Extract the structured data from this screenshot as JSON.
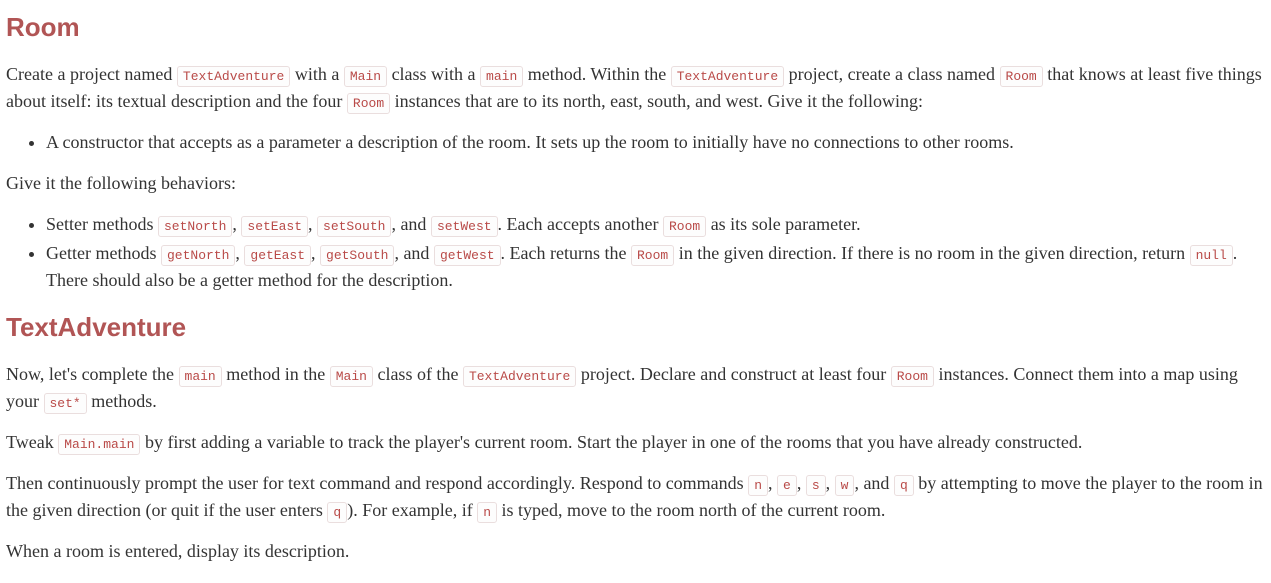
{
  "sections": {
    "room": {
      "heading": "Room",
      "p1": {
        "t1": "Create a project named ",
        "c1": "TextAdventure",
        "t2": " with a ",
        "c2": "Main",
        "t3": " class with a ",
        "c3": "main",
        "t4": " method. Within the ",
        "c4": "TextAdventure",
        "t5": " project, create a class named ",
        "c5": "Room",
        "t6": " that knows at least five things about itself: its textual description and the four ",
        "c6": "Room",
        "t7": " instances that are to its north, east, south, and west. Give it the following:"
      },
      "list1": {
        "li1": "A constructor that accepts as a parameter a description of the room. It sets up the room to initially have no connections to other rooms."
      },
      "p2": "Give it the following behaviors:",
      "list2": {
        "li1": {
          "t1": "Setter methods ",
          "c1": "setNorth",
          "t2": ", ",
          "c2": "setEast",
          "t3": ", ",
          "c3": "setSouth",
          "t4": ", and ",
          "c4": "setWest",
          "t5": ". Each accepts another ",
          "c5": "Room",
          "t6": " as its sole parameter."
        },
        "li2": {
          "t1": "Getter methods ",
          "c1": "getNorth",
          "t2": ", ",
          "c2": "getEast",
          "t3": ", ",
          "c3": "getSouth",
          "t4": ", and ",
          "c4": "getWest",
          "t5": ". Each returns the ",
          "c5": "Room",
          "t6": " in the given direction. If there is no room in the given direction, return ",
          "c6": "null",
          "t7": ". There should also be a getter method for the description."
        }
      }
    },
    "textadventure": {
      "heading": "TextAdventure",
      "p1": {
        "t1": "Now, let's complete the ",
        "c1": "main",
        "t2": " method in the ",
        "c2": "Main",
        "t3": " class of the ",
        "c3": "TextAdventure",
        "t4": " project. Declare and construct at least four ",
        "c4": "Room",
        "t5": " instances. Connect them into a map using your ",
        "c5": "set*",
        "t6": " methods."
      },
      "p2": {
        "t1": "Tweak ",
        "c1": "Main.main",
        "t2": " by first adding a variable to track the player's current room. Start the player in one of the rooms that you have already constructed."
      },
      "p3": {
        "t1": "Then continuously prompt the user for text command and respond accordingly. Respond to commands ",
        "c1": "n",
        "t2": ", ",
        "c2": "e",
        "t3": ", ",
        "c3": "s",
        "t4": ", ",
        "c4": "w",
        "t5": ", and ",
        "c5": "q",
        "t6": " by attempting to move the player to the room in the given direction (or quit if the user enters ",
        "c6": "q",
        "t7": "). For example, if ",
        "c7": "n",
        "t8": " is typed, move to the room north of the current room."
      },
      "p4": "When a room is entered, display its description."
    }
  }
}
